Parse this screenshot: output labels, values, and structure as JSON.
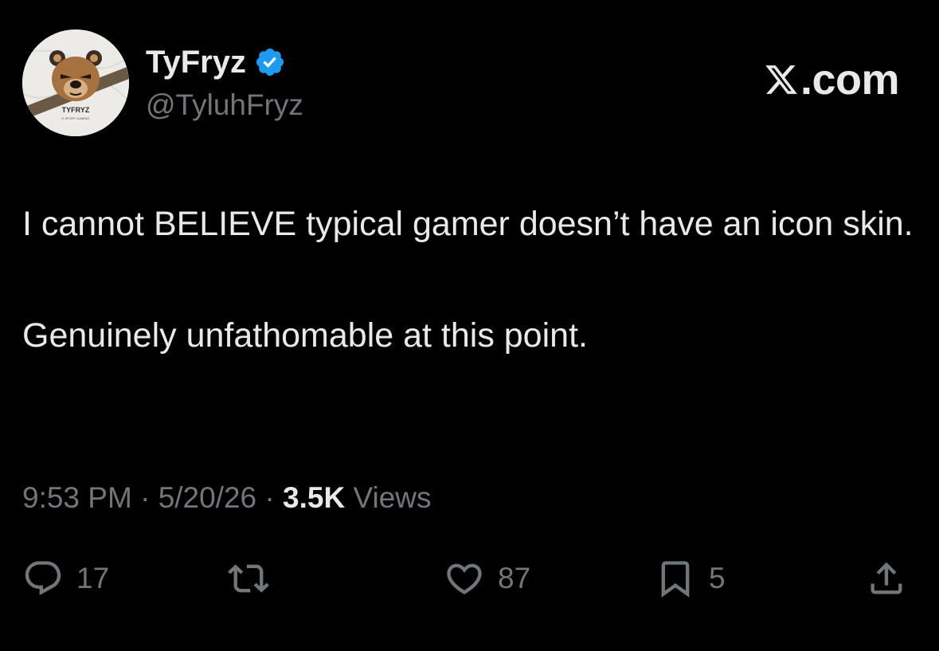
{
  "author": {
    "display_name": "TyFryz",
    "handle": "@TyluhFryz",
    "avatar_text": "TYFRYZ",
    "avatar_subtext": "E-SPORT GAMING",
    "verified": true
  },
  "brand": {
    "text": ".com",
    "logo_icon": "x-logo-icon"
  },
  "tweet": {
    "paragraphs": [
      "I cannot BELIEVE typical gamer doesn’t have an icon skin.",
      "Genuinely unfathomable at this point."
    ]
  },
  "meta": {
    "time": "9:53 PM",
    "separator": " · ",
    "date": "5/20/26",
    "views_count": "3.5K",
    "views_label": " Views"
  },
  "actions": {
    "reply": {
      "icon": "reply-icon",
      "count": "17"
    },
    "repost": {
      "icon": "repost-icon",
      "count": ""
    },
    "like": {
      "icon": "heart-icon",
      "count": "87"
    },
    "bookmark": {
      "icon": "bookmark-icon",
      "count": "5"
    },
    "share": {
      "icon": "share-icon"
    }
  },
  "colors": {
    "background": "#000000",
    "primary_text": "#e7e9ea",
    "secondary_text": "#71767b",
    "verified_blue": "#1d9bf0"
  }
}
